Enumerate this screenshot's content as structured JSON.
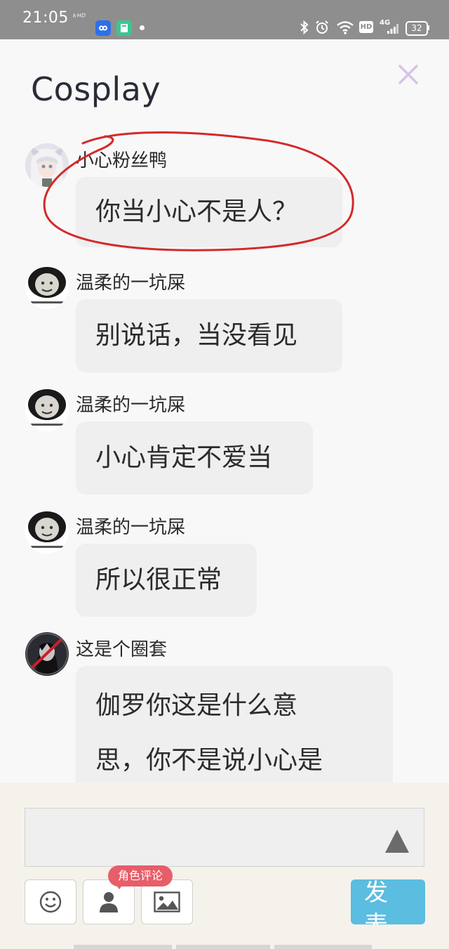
{
  "status_bar": {
    "time": "21:05",
    "carrier_text": "ᵏᴴᴰ",
    "network_label": "4G",
    "hd_label": "HD",
    "battery": "32"
  },
  "header": {
    "title": "Cosplay",
    "close_icon": "close-icon",
    "close_color": "#d6c3ea"
  },
  "messages": [
    {
      "user": "小心粉丝鸭",
      "text": "你当小心不是人？",
      "avatar": "anime-girl-avatar"
    },
    {
      "user": "温柔的一坑屎",
      "text": "别说话，当没看见",
      "avatar": "panda-meme-avatar"
    },
    {
      "user": "温柔的一坑屎",
      "text": "小心肯定不爱当",
      "avatar": "panda-meme-avatar"
    },
    {
      "user": "温柔的一坑屎",
      "text": "所以很正常",
      "avatar": "panda-meme-avatar"
    },
    {
      "user": "这是个圈套",
      "text": "伽罗你这是什么意",
      "text2": "思，你不是说小心是",
      "avatar": "dark-character-avatar"
    }
  ],
  "composer": {
    "input_value": "",
    "send_icon": "send-arrow-icon",
    "tools": [
      "emoji-icon",
      "person-icon",
      "image-icon"
    ],
    "role_tag": "角色评论",
    "publish_label": "发表"
  },
  "colors": {
    "accent_blue": "#5bbde0",
    "tag_red": "#e85d6a",
    "annotation_red": "#d42a2a"
  }
}
